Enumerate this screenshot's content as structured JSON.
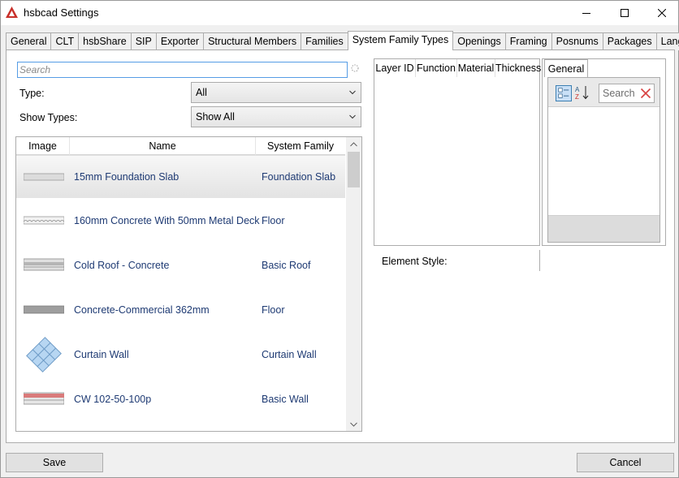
{
  "window": {
    "title": "hsbcad Settings"
  },
  "tabs": [
    {
      "label": "General"
    },
    {
      "label": "CLT"
    },
    {
      "label": "hsbShare"
    },
    {
      "label": "SIP"
    },
    {
      "label": "Exporter"
    },
    {
      "label": "Structural Members"
    },
    {
      "label": "Families"
    },
    {
      "label": "System Family Types",
      "active": true
    },
    {
      "label": "Openings"
    },
    {
      "label": "Framing"
    },
    {
      "label": "Posnums"
    },
    {
      "label": "Packages"
    },
    {
      "label": "Language"
    }
  ],
  "filters": {
    "search_placeholder": "Search",
    "type_label": "Type:",
    "type_value": "All",
    "show_types_label": "Show Types:",
    "show_types_value": "Show All"
  },
  "grid": {
    "columns": [
      "Image",
      "Name",
      "System Family Type"
    ],
    "rows": [
      {
        "name": "15mm Foundation Slab",
        "type": "Foundation Slab",
        "thumb": "slab",
        "selected": true
      },
      {
        "name": "160mm Concrete With 50mm Metal Deck",
        "type": "Floor",
        "thumb": "deck"
      },
      {
        "name": "Cold Roof - Concrete",
        "type": "Basic Roof",
        "thumb": "roof"
      },
      {
        "name": "Concrete-Commercial 362mm",
        "type": "Floor",
        "thumb": "floor"
      },
      {
        "name": "Curtain Wall",
        "type": "Curtain Wall",
        "thumb": "curtain"
      },
      {
        "name": "CW 102-50-100p",
        "type": "Basic Wall",
        "thumb": "wall"
      }
    ]
  },
  "layers": {
    "columns": [
      "Layer ID",
      "Function",
      "Material",
      "Thickness"
    ]
  },
  "properties": {
    "tab_label": "General",
    "search_placeholder": "Search"
  },
  "element_style": {
    "label": "Element Style:"
  },
  "buttons": {
    "save": "Save",
    "cancel": "Cancel"
  },
  "colors": {
    "accent": "#569de5",
    "row_text": "#1e3a73",
    "app_icon": "#c8302a"
  }
}
